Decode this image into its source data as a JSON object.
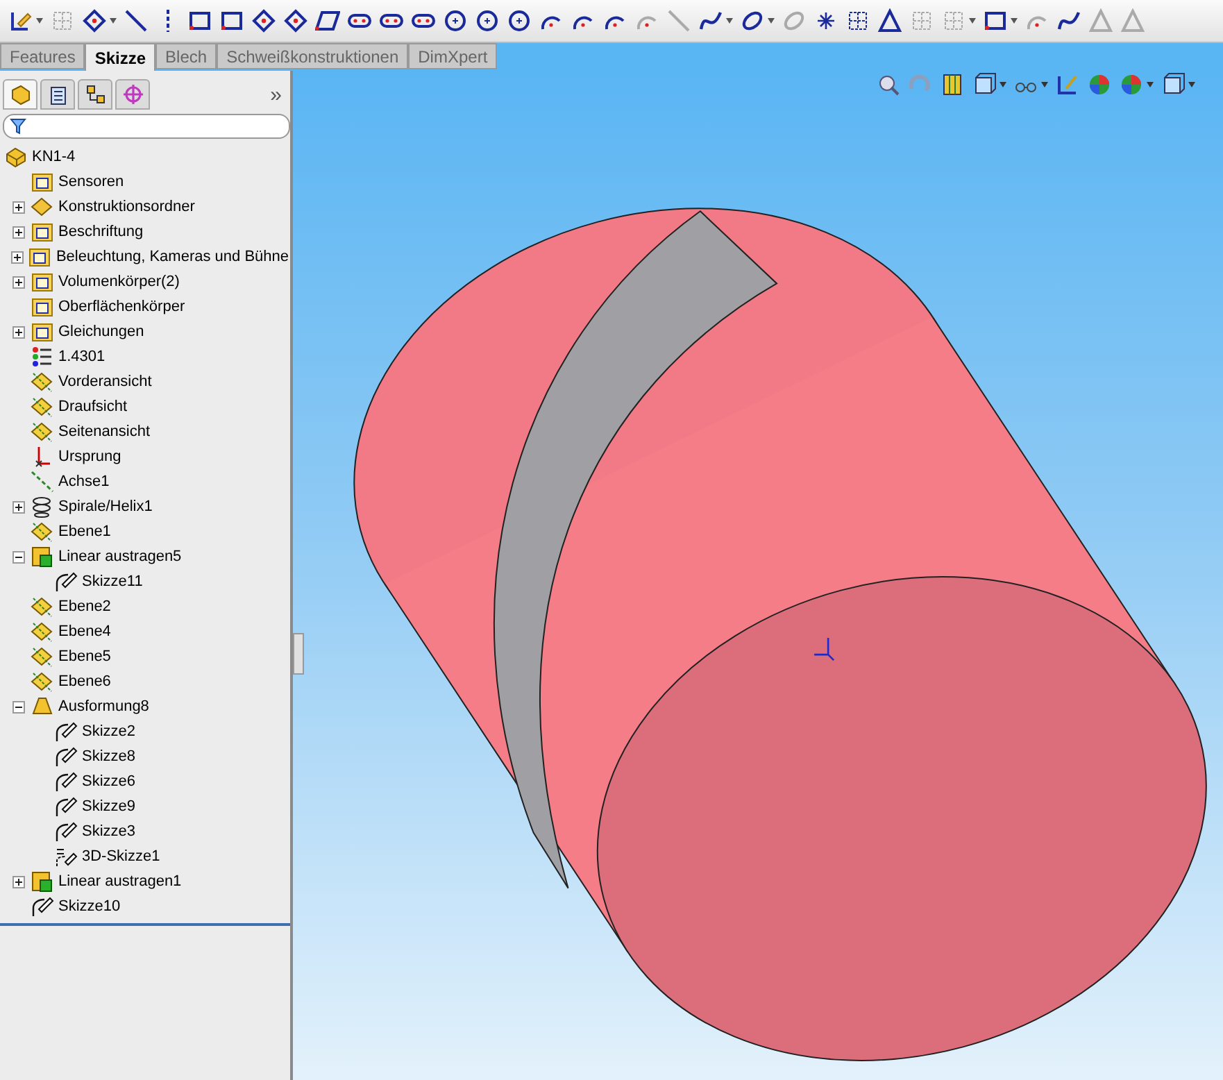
{
  "tabs": [
    {
      "label": "Features",
      "selected": false
    },
    {
      "label": "Skizze",
      "selected": true
    },
    {
      "label": "Blech",
      "selected": false
    },
    {
      "label": "Schweißkonstruktionen",
      "selected": false
    },
    {
      "label": "DimXpert",
      "selected": false
    }
  ],
  "panel_tabs": [
    {
      "kind": "tree",
      "selected": true
    },
    {
      "kind": "properties",
      "selected": false
    },
    {
      "kind": "config",
      "selected": false
    },
    {
      "kind": "target",
      "selected": false
    }
  ],
  "panel_more": "»",
  "tree": {
    "label": "KN1-4",
    "kind": "part",
    "children": [
      {
        "label": "Sensoren",
        "kind": "sensor"
      },
      {
        "label": "Konstruktionsordner",
        "kind": "design",
        "expanded": false
      },
      {
        "label": "Beschriftung",
        "kind": "annotation",
        "expanded": false
      },
      {
        "label": "Beleuchtung, Kameras und Bühne",
        "kind": "lights",
        "expanded": false
      },
      {
        "label": "Volumenkörper(2)",
        "kind": "solid",
        "expanded": false
      },
      {
        "label": "Oberflächenkörper",
        "kind": "surface"
      },
      {
        "label": "Gleichungen",
        "kind": "equation",
        "expanded": false
      },
      {
        "label": "1.4301",
        "kind": "material"
      },
      {
        "label": "Vorderansicht",
        "kind": "plane"
      },
      {
        "label": "Draufsicht",
        "kind": "plane"
      },
      {
        "label": "Seitenansicht",
        "kind": "plane"
      },
      {
        "label": "Ursprung",
        "kind": "origin"
      },
      {
        "label": "Achse1",
        "kind": "axis"
      },
      {
        "label": "Spirale/Helix1",
        "kind": "helix",
        "expanded": false
      },
      {
        "label": "Ebene1",
        "kind": "plane"
      },
      {
        "label": "Linear austragen5",
        "kind": "extrude",
        "expanded": true,
        "children": [
          {
            "label": "Skizze11",
            "kind": "sketch"
          }
        ]
      },
      {
        "label": "Ebene2",
        "kind": "plane"
      },
      {
        "label": "Ebene4",
        "kind": "plane"
      },
      {
        "label": "Ebene5",
        "kind": "plane"
      },
      {
        "label": "Ebene6",
        "kind": "plane"
      },
      {
        "label": "Ausformung8",
        "kind": "loft",
        "expanded": true,
        "children": [
          {
            "label": "Skizze2",
            "kind": "sketch"
          },
          {
            "label": "Skizze8",
            "kind": "sketch"
          },
          {
            "label": "Skizze6",
            "kind": "sketch"
          },
          {
            "label": "Skizze9",
            "kind": "sketch"
          },
          {
            "label": "Skizze3",
            "kind": "sketch"
          },
          {
            "label": "3D-Skizze1",
            "kind": "sketch3d"
          }
        ]
      },
      {
        "label": "Linear austragen1",
        "kind": "extrude",
        "expanded": false
      },
      {
        "label": "Skizze10",
        "kind": "sketch"
      }
    ]
  }
}
